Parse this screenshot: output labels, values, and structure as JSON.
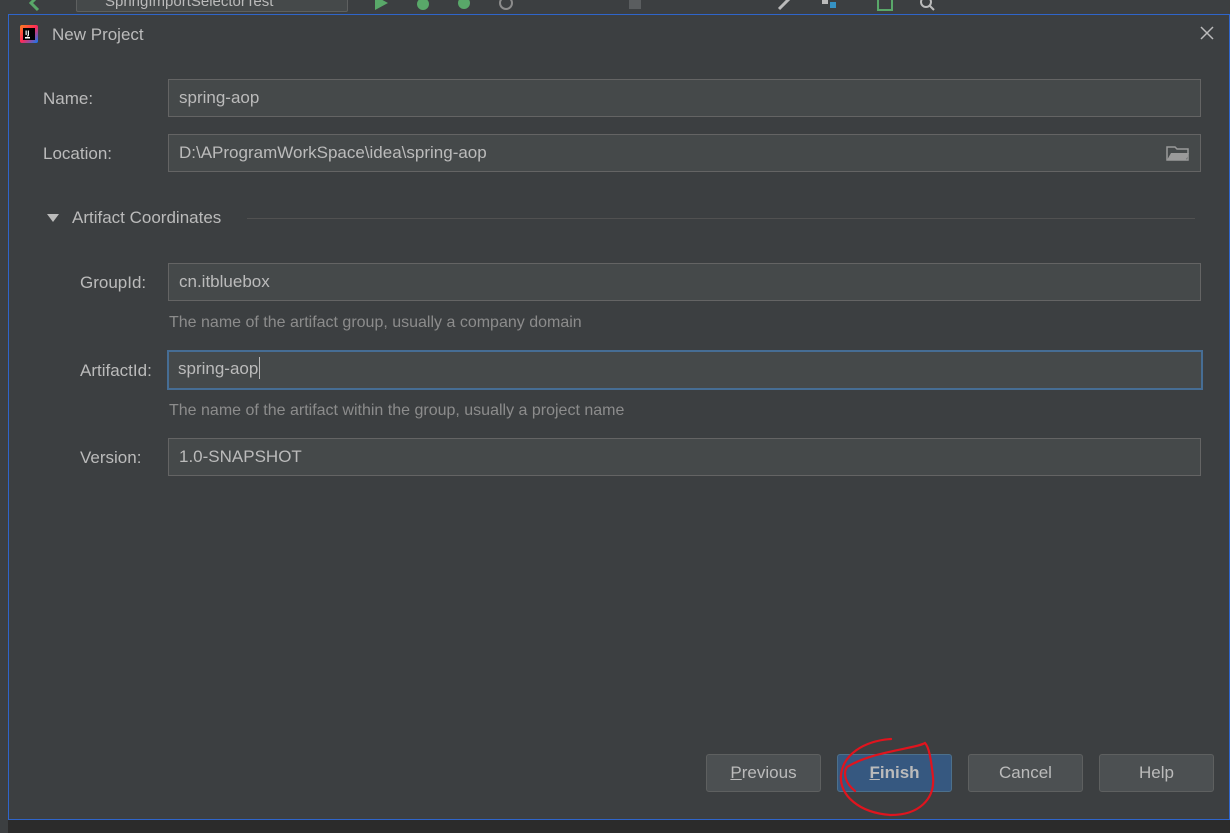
{
  "ide": {
    "run_config": "SpringImportSelectorTest"
  },
  "dialog": {
    "title": "New Project",
    "name_label": "Name:",
    "name_value": "spring-aop",
    "location_label": "Location:",
    "location_value": "D:\\AProgramWorkSpace\\idea\\spring-aop",
    "section_title": "Artifact Coordinates",
    "groupid_label": "GroupId:",
    "groupid_value": "cn.itbluebox",
    "groupid_hint": "The name of the artifact group, usually a company domain",
    "artifactid_label": "ArtifactId:",
    "artifactid_value": "spring-aop",
    "artifactid_hint": "The name of the artifact within the group, usually a project name",
    "version_label": "Version:",
    "version_value": "1.0-SNAPSHOT"
  },
  "buttons": {
    "previous_first": "P",
    "previous_rest": "revious",
    "finish_first": "F",
    "finish_rest": "inish",
    "cancel": "Cancel",
    "help": "Help"
  },
  "colors": {
    "dialog_bg": "#3c3f41",
    "field_bg": "#45494a",
    "focus_border": "#466d94",
    "primary_button": "#365880",
    "annotation": "#e0141e"
  },
  "icons": [
    "intellij-app-icon",
    "close-icon",
    "folder-icon",
    "collapse-triangle-icon",
    "run-icon",
    "debug-icon"
  ]
}
